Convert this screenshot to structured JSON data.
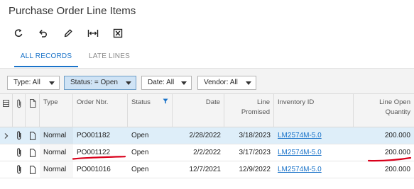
{
  "page": {
    "title": "Purchase Order Line Items"
  },
  "toolbar": {
    "buttons": [
      {
        "name": "refresh",
        "icon": "refresh-icon"
      },
      {
        "name": "undo",
        "icon": "undo-icon"
      },
      {
        "name": "edit",
        "icon": "pencil-icon"
      },
      {
        "name": "fit-columns",
        "icon": "fit-columns-icon"
      },
      {
        "name": "export-excel",
        "icon": "excel-icon"
      }
    ]
  },
  "tabs": [
    {
      "label": "ALL RECORDS",
      "active": true
    },
    {
      "label": "LATE LINES",
      "active": false
    }
  ],
  "filters": [
    {
      "label": "Type: All",
      "selected": false
    },
    {
      "label": "Status: = Open",
      "selected": true
    },
    {
      "label": "Date: All",
      "selected": false
    },
    {
      "label": "Vendor: All",
      "selected": false
    }
  ],
  "grid": {
    "columns": {
      "type": "Type",
      "order_nbr": "Order Nbr.",
      "status": "Status",
      "date": "Date",
      "line_promised_1": "Line",
      "line_promised_2": "Promised",
      "inventory_id": "Inventory ID",
      "line_open_qty_1": "Line Open",
      "line_open_qty_2": "Quantity"
    },
    "rows": [
      {
        "type": "Normal",
        "order_nbr": "PO001182",
        "status": "Open",
        "date": "2/28/2022",
        "line_promised": "3/18/2023",
        "inventory_id": "LM2574M-5.0",
        "line_open_qty": "200.000"
      },
      {
        "type": "Normal",
        "order_nbr": "PO001122",
        "status": "Open",
        "date": "2/2/2022",
        "line_promised": "3/17/2023",
        "inventory_id": "LM2574M-5.0",
        "line_open_qty": "200.000"
      },
      {
        "type": "Normal",
        "order_nbr": "PO001016",
        "status": "Open",
        "date": "12/7/2021",
        "line_promised": "12/9/2022",
        "inventory_id": "LM2574M-5.0",
        "line_open_qty": "200.000"
      }
    ]
  },
  "colors": {
    "accent": "#1a73c9",
    "selected_row": "#deeef9",
    "selected_filter": "#cfe3f5",
    "annotation_red": "#d9001b"
  }
}
